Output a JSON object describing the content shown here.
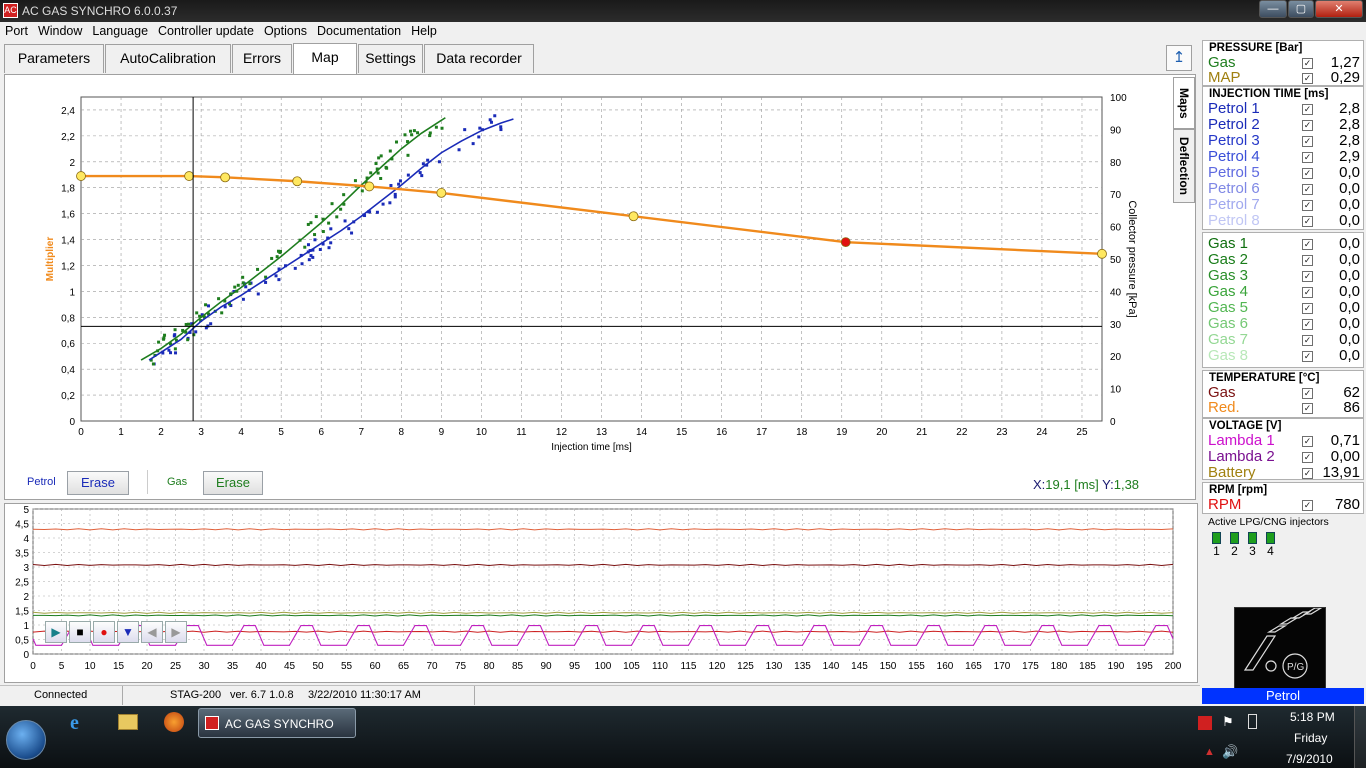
{
  "window": {
    "title": "AC GAS SYNCHRO 6.0.0.37",
    "icon": "ac-app-icon",
    "controls": [
      "minimize",
      "maximize",
      "close"
    ]
  },
  "menu": [
    "Port",
    "Window",
    "Language",
    "Controller update",
    "Options",
    "Documentation",
    "Help"
  ],
  "tabs": [
    "Parameters",
    "AutoCalibration",
    "Errors",
    "Map",
    "Settings",
    "Data recorder"
  ],
  "active_tab": "Map",
  "side_tabs": [
    "Maps",
    "Deflection"
  ],
  "map_panel": {
    "petrol_label": "Petrol",
    "gas_label": "Gas",
    "erase_label": "Erase",
    "cursor_readout": {
      "x_label": "X:",
      "x_value": "19,1 [ms]",
      "y_label": "Y:",
      "y_value": "1,38"
    },
    "colors": {
      "petrol": "#1a2bb8",
      "gas": "#1e7d1e",
      "multiplier": "#f08a1c",
      "readout": "#1a1a70",
      "readout_val": "#1e7d1e"
    }
  },
  "chart_data": [
    {
      "type": "scatter",
      "xlabel": "Injection time [ms]",
      "ylabel": "Multiplier",
      "y2label": "Collector pressure [kPa]",
      "xlim": [
        0,
        25.5
      ],
      "ylim": [
        0,
        2.5
      ],
      "y2lim": [
        0,
        100
      ],
      "xticks": [
        0,
        1,
        2,
        3,
        4,
        5,
        6,
        7,
        8,
        9,
        10,
        11,
        12,
        13,
        14,
        15,
        16,
        17,
        18,
        19,
        20,
        21,
        22,
        23,
        24,
        25
      ],
      "yticks": [
        "0",
        "0,2",
        "0,4",
        "0,6",
        "0,8",
        "1",
        "1,2",
        "1,4",
        "1,6",
        "1,8",
        "2",
        "2,2",
        "2,4"
      ],
      "y2ticks": [
        0,
        10,
        20,
        30,
        40,
        50,
        60,
        70,
        80,
        90,
        100
      ],
      "crosshair": {
        "x": 2.8,
        "y": 0.73
      },
      "series": [
        {
          "name": "Petrol",
          "values": [
            [
              1.7,
              0.47
            ],
            [
              2.0,
              0.53
            ],
            [
              2.5,
              0.63
            ],
            [
              3.0,
              0.77
            ],
            [
              3.5,
              0.88
            ],
            [
              4.0,
              0.97
            ],
            [
              4.5,
              1.07
            ],
            [
              5.0,
              1.17
            ],
            [
              5.5,
              1.27
            ],
            [
              6.0,
              1.37
            ],
            [
              6.5,
              1.47
            ],
            [
              7.0,
              1.58
            ],
            [
              7.5,
              1.7
            ],
            [
              8.0,
              1.82
            ],
            [
              8.5,
              1.95
            ],
            [
              9.0,
              2.07
            ],
            [
              9.5,
              2.16
            ],
            [
              10.0,
              2.24
            ],
            [
              10.5,
              2.3
            ],
            [
              10.8,
              2.33
            ]
          ]
        },
        {
          "name": "Gas",
          "values": [
            [
              1.5,
              0.47
            ],
            [
              2.0,
              0.56
            ],
            [
              2.5,
              0.67
            ],
            [
              3.0,
              0.8
            ],
            [
              3.5,
              0.92
            ],
            [
              4.0,
              1.03
            ],
            [
              4.5,
              1.15
            ],
            [
              5.0,
              1.27
            ],
            [
              5.5,
              1.4
            ],
            [
              6.0,
              1.53
            ],
            [
              6.5,
              1.67
            ],
            [
              7.0,
              1.82
            ],
            [
              7.5,
              1.96
            ],
            [
              8.0,
              2.1
            ],
            [
              8.5,
              2.22
            ],
            [
              9.0,
              2.32
            ],
            [
              9.1,
              2.34
            ]
          ]
        },
        {
          "name": "Multiplier",
          "values": [
            [
              0,
              1.89
            ],
            [
              2.7,
              1.89
            ],
            [
              3.6,
              1.88
            ],
            [
              5.4,
              1.85
            ],
            [
              7.2,
              1.81
            ],
            [
              9.0,
              1.76
            ],
            [
              13.8,
              1.58
            ],
            [
              19.1,
              1.38
            ],
            [
              25.5,
              1.29
            ]
          ]
        }
      ],
      "scatter_petrol_count": 85,
      "scatter_gas_count": 85,
      "points": [
        {
          "x": 0,
          "y": 1.89
        },
        {
          "x": 2.7,
          "y": 1.89
        },
        {
          "x": 3.6,
          "y": 1.88
        },
        {
          "x": 5.4,
          "y": 1.85
        },
        {
          "x": 7.2,
          "y": 1.81
        },
        {
          "x": 9.0,
          "y": 1.76
        },
        {
          "x": 13.8,
          "y": 1.58
        },
        {
          "x": 19.1,
          "y": 1.38,
          "selected": true
        },
        {
          "x": 25.5,
          "y": 1.29
        }
      ]
    },
    {
      "type": "line",
      "xlim": [
        0,
        200
      ],
      "ylim": [
        0,
        5
      ],
      "xticks": [
        0,
        5,
        10,
        15,
        20,
        25,
        30,
        35,
        40,
        45,
        50,
        55,
        60,
        65,
        70,
        75,
        80,
        85,
        90,
        95,
        100,
        105,
        110,
        115,
        120,
        125,
        130,
        135,
        140,
        145,
        150,
        155,
        160,
        165,
        170,
        175,
        180,
        185,
        190,
        195,
        200
      ],
      "yticks": [
        "0",
        "0,5",
        "1",
        "1,5",
        "2",
        "2,5",
        "3",
        "3,5",
        "4",
        "4,5",
        "5"
      ],
      "series": [
        {
          "values_const": 4.3,
          "color": "#e0603a"
        },
        {
          "values_const": 3.07,
          "color": "#7a1010"
        },
        {
          "values_const": 1.42,
          "color": "#a0a040"
        },
        {
          "values_const": 1.33,
          "color": "#1e7d1e"
        },
        {
          "values_const": 0.77,
          "color": "#cc2020"
        },
        {
          "wave": true,
          "color": "#c020c0",
          "low": 0.3,
          "high": 0.98,
          "period": 10
        }
      ]
    }
  ],
  "player": {
    "buttons": [
      "play-icon",
      "stop-icon",
      "record-icon",
      "down-icon",
      "left-icon",
      "right-icon"
    ]
  },
  "right_panel": {
    "pressure": {
      "title": "PRESSURE [Bar]",
      "rows": [
        {
          "name": "Gas",
          "value": "1,27",
          "color": "#1e7d1e",
          "checked": "✓"
        },
        {
          "name": "MAP",
          "value": "0,29",
          "color": "#a08010",
          "checked": "✓"
        }
      ]
    },
    "injection": {
      "title": "INJECTION TIME [ms]",
      "petrol": [
        {
          "name": "Petrol 1",
          "value": "2,8",
          "color": "#1a2bb8"
        },
        {
          "name": "Petrol 2",
          "value": "2,8",
          "color": "#1a2bb8"
        },
        {
          "name": "Petrol 3",
          "value": "2,8",
          "color": "#2638c8"
        },
        {
          "name": "Petrol 4",
          "value": "2,9",
          "color": "#3a4fd8"
        },
        {
          "name": "Petrol 5",
          "value": "0,0",
          "color": "#5f6ae0"
        },
        {
          "name": "Petrol 6",
          "value": "0,0",
          "color": "#7f88e5"
        },
        {
          "name": "Petrol 7",
          "value": "0,0",
          "color": "#a0a8ee"
        },
        {
          "name": "Petrol 8",
          "value": "0,0",
          "color": "#c0c6f4"
        }
      ],
      "gas": [
        {
          "name": "Gas 1",
          "value": "0,0",
          "color": "#0f6f0f"
        },
        {
          "name": "Gas 2",
          "value": "0,0",
          "color": "#1a7d1a"
        },
        {
          "name": "Gas 3",
          "value": "0,0",
          "color": "#2a8f2a"
        },
        {
          "name": "Gas 4",
          "value": "0,0",
          "color": "#3aa43a"
        },
        {
          "name": "Gas 5",
          "value": "0,0",
          "color": "#52b652"
        },
        {
          "name": "Gas 6",
          "value": "0,0",
          "color": "#74c874"
        },
        {
          "name": "Gas 7",
          "value": "0,0",
          "color": "#94d894"
        },
        {
          "name": "Gas 8",
          "value": "0,0",
          "color": "#b8e8b8"
        }
      ]
    },
    "temperature": {
      "title": "TEMPERATURE [°C]",
      "rows": [
        {
          "name": "Gas",
          "value": "62",
          "color": "#7a1010"
        },
        {
          "name": "Red.",
          "value": "86",
          "color": "#f08a1c"
        }
      ]
    },
    "voltage": {
      "title": "VOLTAGE [V]",
      "rows": [
        {
          "name": "Lambda 1",
          "value": "0,71",
          "color": "#cc10cc"
        },
        {
          "name": "Lambda 2",
          "value": "0,00",
          "color": "#7a1090"
        },
        {
          "name": "Battery",
          "value": "13,91",
          "color": "#a08010"
        }
      ]
    },
    "rpm": {
      "title": "RPM [rpm]",
      "rows": [
        {
          "name": "RPM",
          "value": "780",
          "color": "#e01010"
        }
      ]
    },
    "injectors": {
      "title": "Active LPG/CNG injectors",
      "labels": [
        "1",
        "2",
        "3",
        "4"
      ]
    },
    "mode": "Petrol"
  },
  "status": {
    "connection": "Connected",
    "device": "STAG-200",
    "version": "ver. 6.7  1.0.8",
    "datetime": "3/22/2010 11:30:17 AM"
  },
  "taskbar": {
    "app_button": "AC GAS SYNCHRO",
    "time": "5:18 PM",
    "day": "Friday",
    "date": "7/9/2010"
  }
}
